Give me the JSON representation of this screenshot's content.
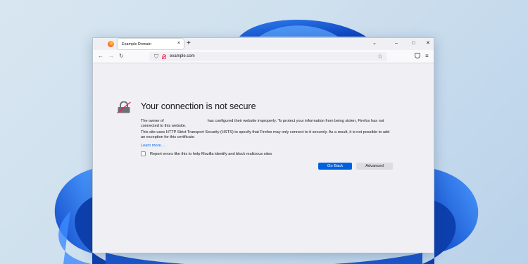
{
  "browser": {
    "tab": {
      "title": "Example Domain",
      "close_glyph": "×"
    },
    "new_tab_glyph": "+",
    "tab_list_glyph": "⌄",
    "window_controls": {
      "minimize": "–",
      "maximize": "□",
      "close": "✕"
    },
    "nav": {
      "back_glyph": "←",
      "forward_glyph": "→",
      "reload_glyph": "↻"
    },
    "url": "example.com",
    "bookmark_glyph": "☆",
    "menu_glyph": "≡"
  },
  "error_page": {
    "title": "Your connection is not secure",
    "paragraph1_prefix": "The owner of",
    "paragraph1_suffix": "has configured their website improperly. To protect your information from being stolen, Firefox has not connected to this website.",
    "paragraph2": "This site uses HTTP Strict Transport Security (HSTS) to specify that Firefox may only connect to it securely. As a result, it is not possible to add an exception for this certificate.",
    "learn_more": "Learn more…",
    "report_checkbox_label": "Report errors like this to help Mozilla identify and block malicious sites",
    "report_checked": false,
    "go_back_label": "Go Back",
    "advanced_label": "Advanced"
  },
  "colors": {
    "primary_button": "#0061e0",
    "link": "#0061e0",
    "insecure_lock": "#e22850",
    "wallpaper_bloom": "#1f5fd6"
  },
  "icons": [
    "firefox-logo-icon",
    "close-icon",
    "plus-icon",
    "chevron-down-icon",
    "minimize-icon",
    "maximize-icon",
    "back-arrow-icon",
    "forward-arrow-icon",
    "reload-icon",
    "shield-icon",
    "insecure-lock-icon",
    "star-icon",
    "pocket-icon",
    "hamburger-menu-icon",
    "broken-lock-icon"
  ]
}
